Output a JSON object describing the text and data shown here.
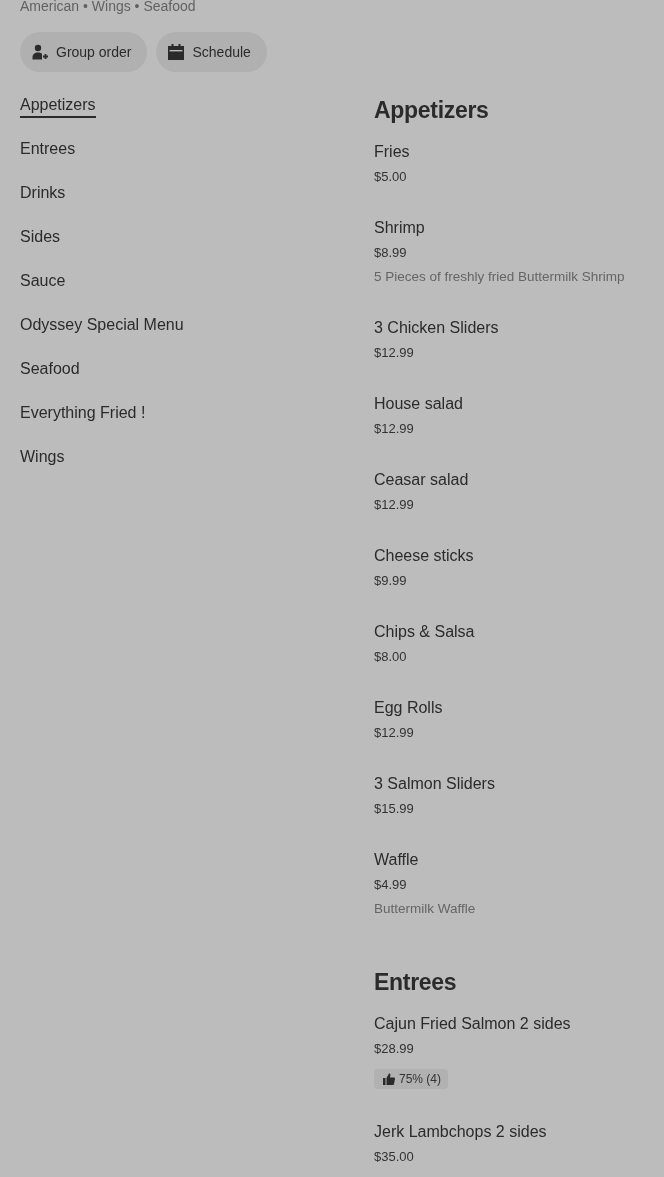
{
  "header": {
    "cuisine": "American • Wings • Seafood",
    "actions": [
      {
        "kind": "group",
        "label": "Group order"
      },
      {
        "kind": "schedule",
        "label": "Schedule"
      }
    ]
  },
  "categories": [
    {
      "label": "Appetizers",
      "selected": true
    },
    {
      "label": "Entrees",
      "selected": false
    },
    {
      "label": "Drinks",
      "selected": false
    },
    {
      "label": "Sides",
      "selected": false
    },
    {
      "label": "Sauce",
      "selected": false
    },
    {
      "label": "Odyssey Special Menu",
      "selected": false
    },
    {
      "label": "Seafood",
      "selected": false
    },
    {
      "label": "Everything Fried !",
      "selected": false
    },
    {
      "label": "Wings",
      "selected": false
    }
  ],
  "sections": [
    {
      "title": "Appetizers",
      "items": [
        {
          "name": "Fries",
          "price": "$5.00"
        },
        {
          "name": "Shrimp",
          "price": "$8.99",
          "description": "5 Pieces of freshly fried Buttermilk Shrimp"
        },
        {
          "name": "3 Chicken Sliders",
          "price": "$12.99"
        },
        {
          "name": "House salad",
          "price": "$12.99"
        },
        {
          "name": "Ceasar salad",
          "price": "$12.99"
        },
        {
          "name": "Cheese sticks",
          "price": "$9.99"
        },
        {
          "name": "Chips & Salsa",
          "price": "$8.00"
        },
        {
          "name": "Egg Rolls",
          "price": "$12.99"
        },
        {
          "name": "3 Salmon Sliders",
          "price": "$15.99"
        },
        {
          "name": "Waffle",
          "price": "$4.99",
          "description": "Buttermilk Waffle"
        }
      ]
    },
    {
      "title": "Entrees",
      "items": [
        {
          "name": "Cajun Fried Salmon 2 sides",
          "price": "$28.99",
          "rating": "75% (4)"
        },
        {
          "name": "Jerk Lambchops 2 sides",
          "price": "$35.00"
        }
      ]
    }
  ]
}
